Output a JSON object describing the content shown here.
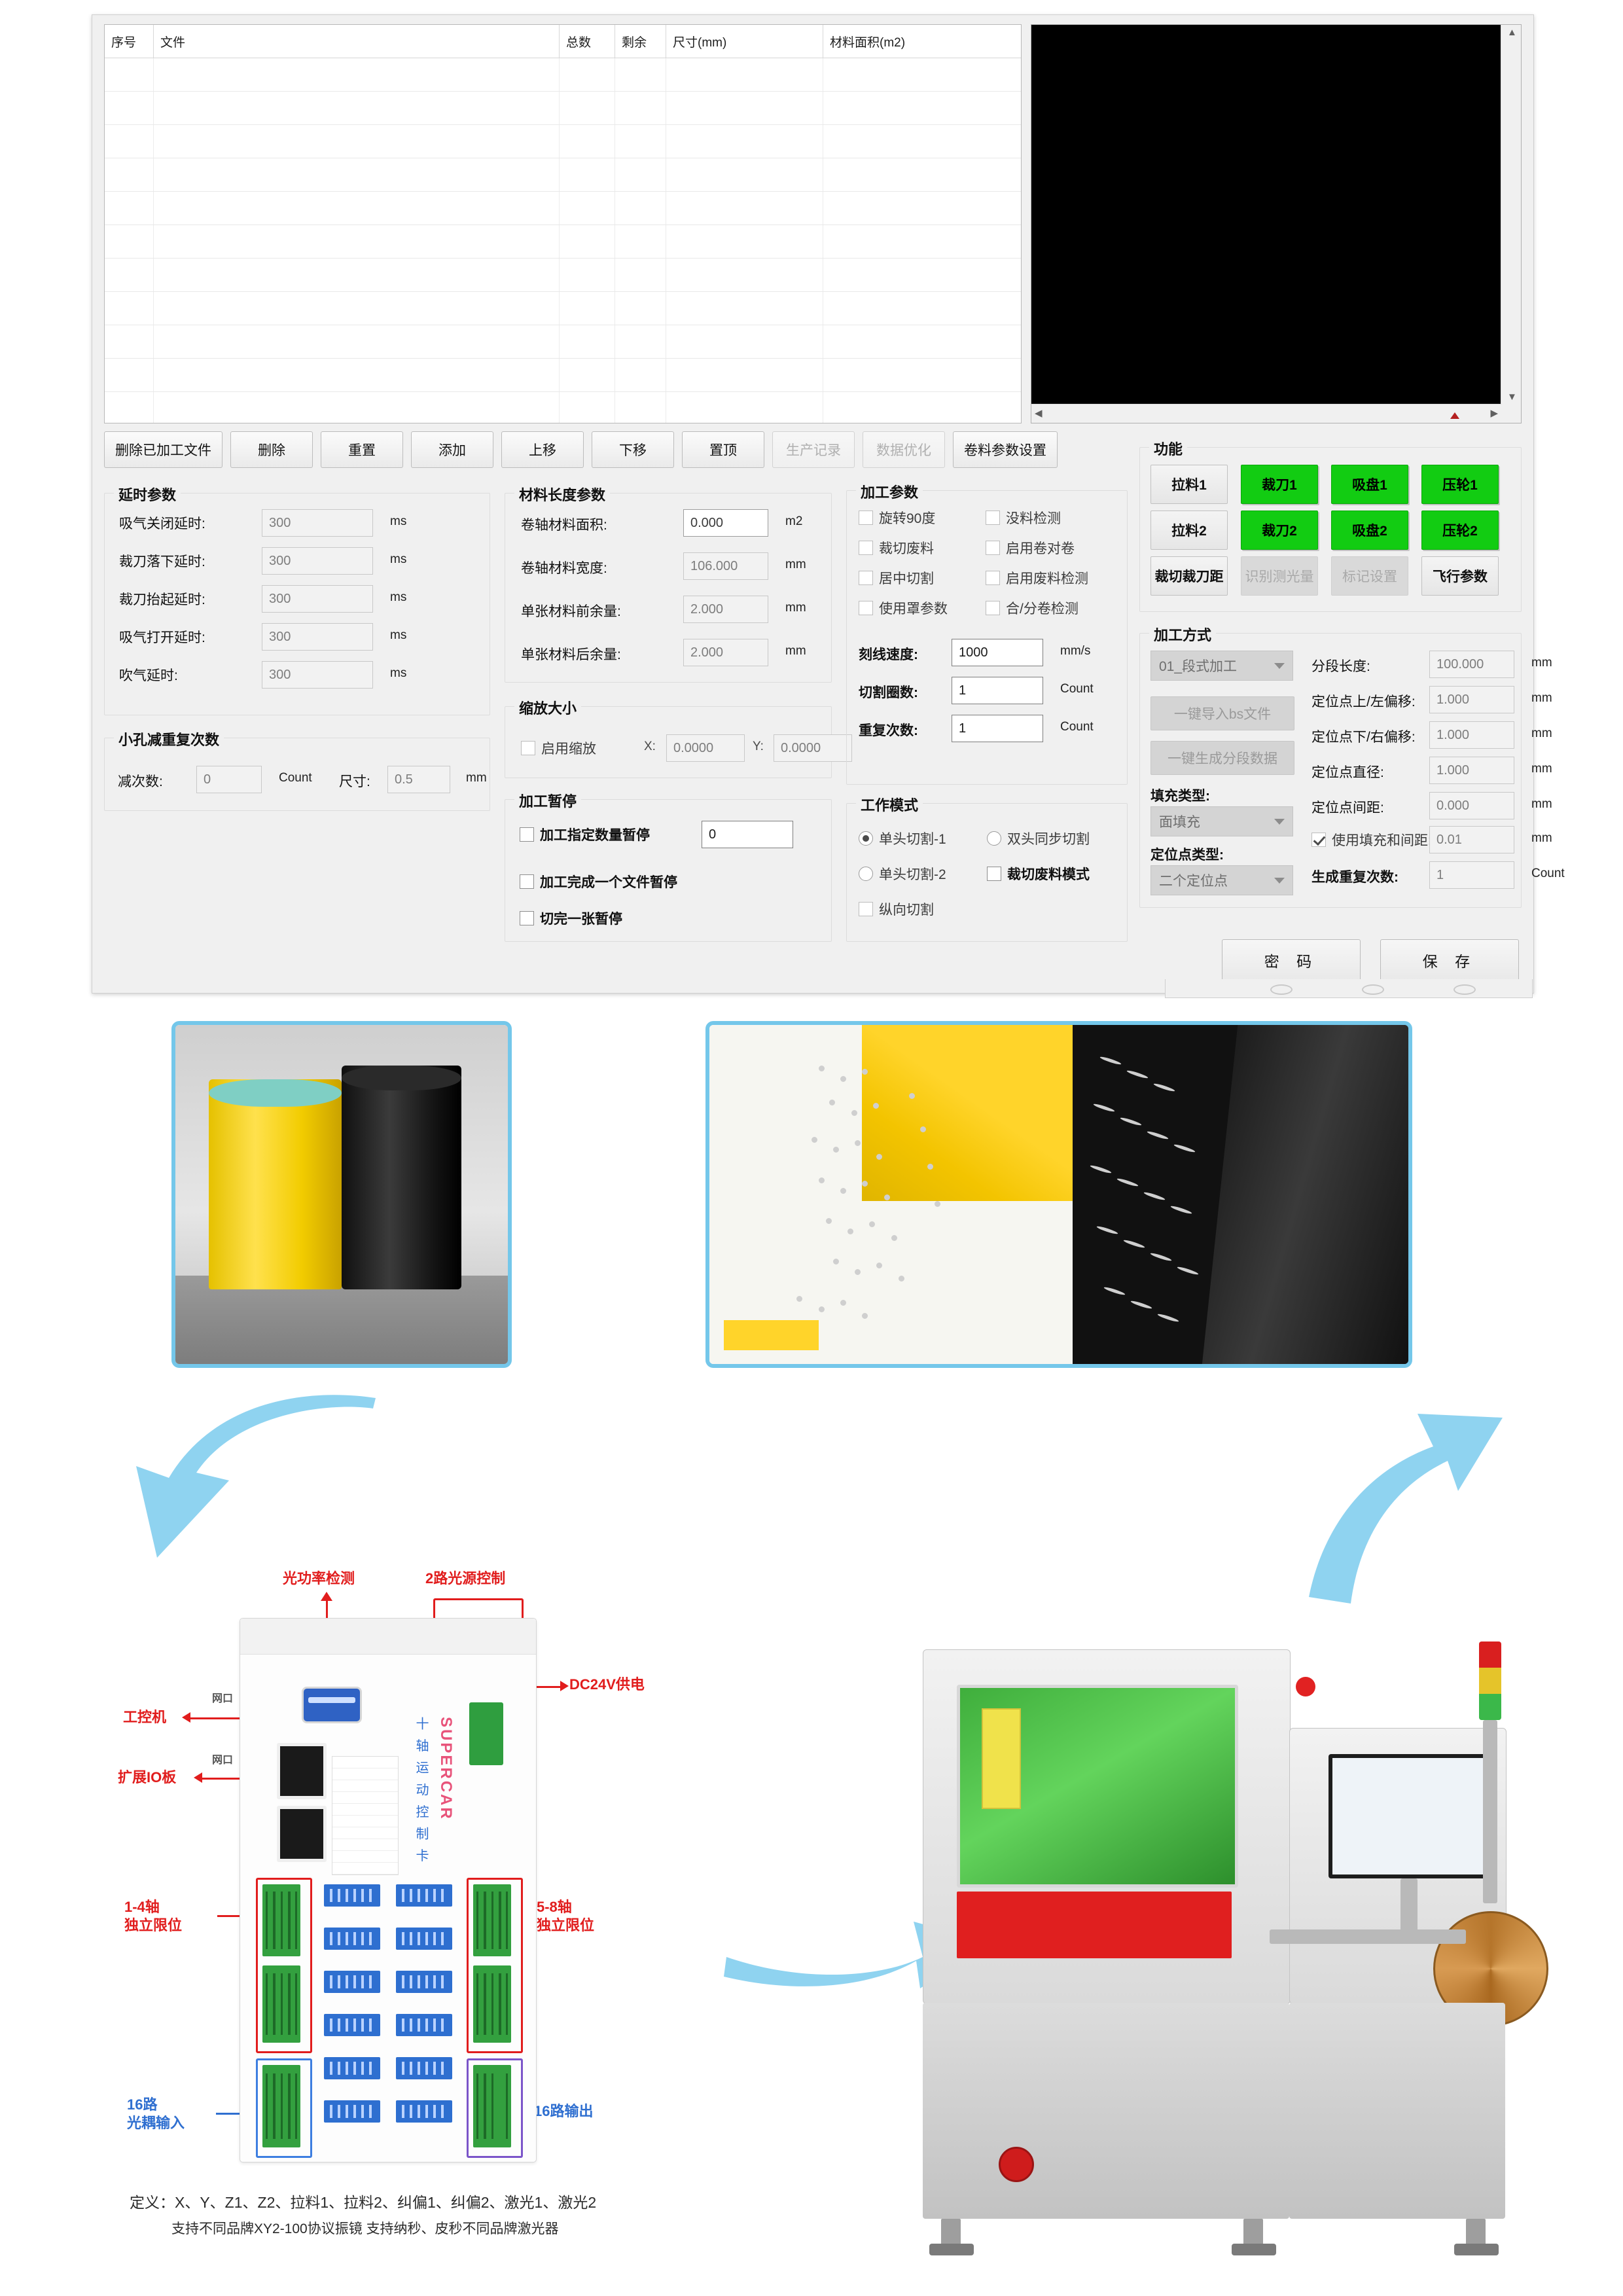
{
  "software": {
    "table": {
      "columns": [
        "序号",
        "文件",
        "总数",
        "剩余",
        "尺寸(mm)",
        "材料面积(m2)"
      ],
      "rows": []
    },
    "toolbar": [
      {
        "label": "删除已加工文件",
        "enabled": true
      },
      {
        "label": "删除",
        "enabled": true
      },
      {
        "label": "重置",
        "enabled": true
      },
      {
        "label": "添加",
        "enabled": true
      },
      {
        "label": "上移",
        "enabled": true
      },
      {
        "label": "下移",
        "enabled": true
      },
      {
        "label": "置顶",
        "enabled": true
      },
      {
        "label": "生产记录",
        "enabled": false
      },
      {
        "label": "数据优化",
        "enabled": false
      },
      {
        "label": "卷料参数设置",
        "enabled": true
      }
    ],
    "delay_group": {
      "title": "延时参数",
      "fields": [
        {
          "label": "吸气关闭延时:",
          "value": "300",
          "unit": "ms"
        },
        {
          "label": "裁刀落下延时:",
          "value": "300",
          "unit": "ms"
        },
        {
          "label": "裁刀抬起延时:",
          "value": "300",
          "unit": "ms"
        },
        {
          "label": "吸气打开延时:",
          "value": "300",
          "unit": "ms"
        },
        {
          "label": "吹气延时:",
          "value": "300",
          "unit": "ms"
        }
      ]
    },
    "hole_group": {
      "title": "小孔减重复次数",
      "count_label": "减次数:",
      "count_value": "0",
      "count_unit": "Count",
      "size_label": "尺寸:",
      "size_value": "0.5",
      "size_unit": "mm"
    },
    "material_group": {
      "title": "材料长度参数",
      "fields": [
        {
          "label": "卷轴材料面积:",
          "value": "0.000",
          "unit": "m2"
        },
        {
          "label": "卷轴材料宽度:",
          "value": "106.000",
          "unit": "mm"
        },
        {
          "label": "单张材料前余量:",
          "value": "2.000",
          "unit": "mm"
        },
        {
          "label": "单张材料后余量:",
          "value": "2.000",
          "unit": "mm"
        }
      ]
    },
    "scale_group": {
      "title": "缩放大小",
      "enable_label": "启用缩放",
      "enable_checked": false,
      "x_label": "X:",
      "x_value": "0.0000",
      "y_label": "Y:",
      "y_value": "0.0000"
    },
    "pause_group": {
      "title": "加工暂停",
      "items": [
        {
          "label": "加工指定数量暂停",
          "checked": false,
          "value": "0"
        },
        {
          "label": "加工完成一个文件暂停",
          "checked": false
        },
        {
          "label": "切完一张暂停",
          "checked": false
        }
      ]
    },
    "process_group": {
      "title": "加工参数",
      "left_checks": [
        {
          "label": "旋转90度",
          "checked": false
        },
        {
          "label": "裁切废料",
          "checked": false
        },
        {
          "label": "居中切割",
          "checked": false
        },
        {
          "label": "使用罩参数",
          "checked": false
        }
      ],
      "right_checks": [
        {
          "label": "没料检测",
          "checked": false
        },
        {
          "label": "启用卷对卷",
          "checked": false
        },
        {
          "label": "启用废料检测",
          "checked": false
        },
        {
          "label": "合/分卷检测",
          "checked": false
        }
      ],
      "fields": [
        {
          "label": "刻线速度:",
          "value": "1000",
          "unit": "mm/s"
        },
        {
          "label": "切割圈数:",
          "value": "1",
          "unit": "Count"
        },
        {
          "label": "重复次数:",
          "value": "1",
          "unit": "Count"
        }
      ]
    },
    "work_mode_group": {
      "title": "工作模式",
      "options": [
        {
          "label": "单头切割-1",
          "type": "radio",
          "checked": true
        },
        {
          "label": "双头同步切割",
          "type": "radio",
          "checked": false
        },
        {
          "label": "单头切割-2",
          "type": "radio",
          "checked": false
        },
        {
          "label": "裁切废料模式",
          "type": "checkbox",
          "checked": false
        },
        {
          "label": "纵向切割",
          "type": "checkbox",
          "checked": false
        }
      ]
    },
    "function_group": {
      "title": "功能",
      "buttons": [
        {
          "label": "拉料1",
          "state": "grey"
        },
        {
          "label": "裁刀1",
          "state": "green"
        },
        {
          "label": "吸盘1",
          "state": "green"
        },
        {
          "label": "压轮1",
          "state": "green"
        },
        {
          "label": "拉料2",
          "state": "grey"
        },
        {
          "label": "裁刀2",
          "state": "green"
        },
        {
          "label": "吸盘2",
          "state": "green"
        },
        {
          "label": "压轮2",
          "state": "green"
        },
        {
          "label": "裁切裁刀距",
          "state": "grey"
        },
        {
          "label": "识别测光量",
          "state": "off"
        },
        {
          "label": "标记设置",
          "state": "off"
        },
        {
          "label": "飞行参数",
          "state": "grey"
        }
      ]
    },
    "method_group": {
      "title": "加工方式",
      "mode_select": "01_段式加工",
      "import_button": "一键导入bs文件",
      "generate_button": "一键生成分段数据",
      "fill_type_label": "填充类型:",
      "fill_type_value": "面填充",
      "locate_type_label": "定位点类型:",
      "locate_type_value": "二个定位点",
      "fields": [
        {
          "label": "分段长度:",
          "value": "100.000",
          "unit": "mm"
        },
        {
          "label": "定位点上/左偏移:",
          "value": "1.000",
          "unit": "mm"
        },
        {
          "label": "定位点下/右偏移:",
          "value": "1.000",
          "unit": "mm"
        },
        {
          "label": "定位点直径:",
          "value": "1.000",
          "unit": "mm"
        },
        {
          "label": "定位点间距:",
          "value": "0.000",
          "unit": "mm"
        }
      ],
      "fill_gap": {
        "label": "使用填充和间距:",
        "checked": true,
        "value": "0.01",
        "unit": "mm"
      },
      "repeat": {
        "label": "生成重复次数:",
        "value": "1",
        "unit": "Count"
      }
    },
    "footer_buttons": [
      {
        "label": "密 码"
      },
      {
        "label": "保 存"
      }
    ]
  },
  "diagram": {
    "annotations": {
      "power_detect": "光功率检测",
      "two_light": "2路光源控制",
      "dc24v": "DC24V供电",
      "ipc": "工控机",
      "ipc_port": "网口",
      "expand_io": "扩展IO板",
      "expand_port": "网口",
      "axis_1_4": "1-4轴\n独立限位",
      "axis_5_8": "5-8轴\n独立限位",
      "in16": "16路\n光耦输入",
      "out16": "16路输出"
    },
    "brand": "SUPERCAR",
    "brand_sub": "十 轴 运 动 控 制 卡",
    "caption_line1": "定义：X、Y、Z1、Z2、拉料1、拉料2、纠偏1、纠偏2、激光1、激光2",
    "caption_line2": "支持不同品牌XY2-100协议振镜  支持纳秒、皮秒不同品牌激光器"
  },
  "colors": {
    "accent_blue": "#74c7ea",
    "green_on": "#12cc12",
    "annotation_red": "#e11d1d",
    "annotation_blue": "#2f6fd0"
  }
}
